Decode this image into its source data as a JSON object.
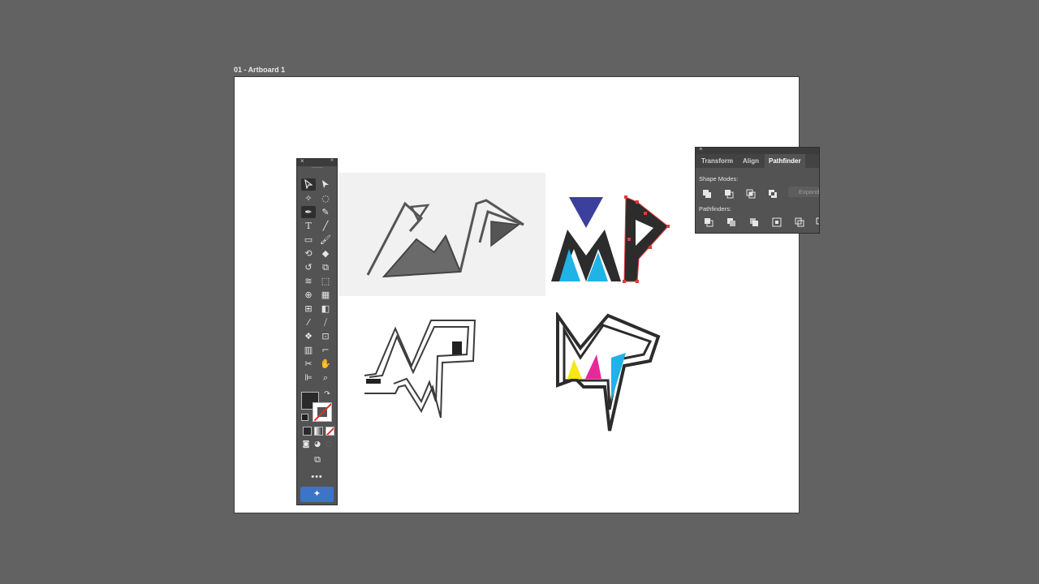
{
  "artboard": {
    "label": "01 - Artboard 1"
  },
  "toolbar": {
    "close_icon": "×",
    "collapse_icon": "»",
    "more_label": "•••"
  },
  "pathfinder_panel": {
    "close_icon": "×",
    "tabs": [
      {
        "label": "Transform"
      },
      {
        "label": "Align"
      },
      {
        "label": "Pathfinder",
        "active": true
      }
    ],
    "shape_modes_label": "Shape Modes:",
    "expand_label": "Expand",
    "pathfinders_label": "Pathfinders:"
  },
  "colors": {
    "canvas_bg": "#626262",
    "panel_bg": "#535353",
    "logo_navy": "#3d3f9c",
    "logo_cyan": "#1fb3e6",
    "logo_magenta": "#e8289a",
    "logo_yellow": "#f5e614",
    "logo_dark": "#2c2c2c",
    "selection_red": "#e33939",
    "accent_blue": "#3d74c8"
  }
}
